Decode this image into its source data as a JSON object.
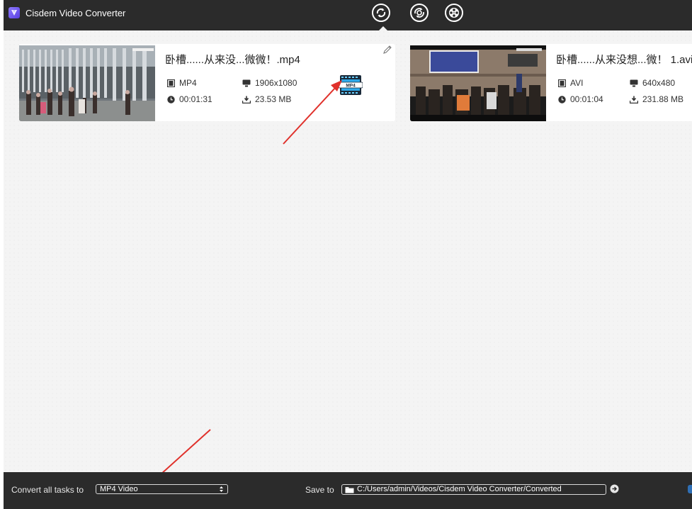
{
  "app": {
    "title": "Cisdem Video Converter"
  },
  "modes": [
    {
      "icon": "convert-icon",
      "active": true
    },
    {
      "icon": "rip-icon",
      "active": false
    },
    {
      "icon": "download-icon",
      "active": false
    }
  ],
  "files": [
    {
      "name": "卧槽......从来没...微微！.mp4",
      "format": "MP4",
      "resolution": "1906x1080",
      "duration": "00:01:31",
      "size": "23.53 MB",
      "output_badge": "MP4"
    },
    {
      "name": "卧槽......从来没想...微！ 1.avi",
      "format": "AVI",
      "resolution": "640x480",
      "duration": "00:01:04",
      "size": "231.88 MB"
    }
  ],
  "footer": {
    "convert_label": "Convert all tasks to",
    "convert_value": "MP4 Video",
    "save_label": "Save to",
    "save_path": "C:/Users/admin/Videos/Cisdem Video Converter/Converted"
  },
  "colors": {
    "titlebar": "#2b2b2b",
    "background": "#f4f4f4",
    "annotation_arrow": "#e0312b",
    "logo": "#6b54f0"
  }
}
